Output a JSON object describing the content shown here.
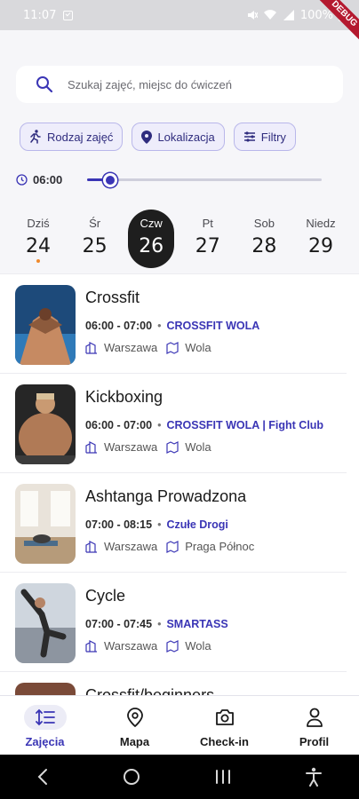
{
  "status_bar": {
    "time": "11:07",
    "battery": "100%",
    "debug_label": "DEBUG"
  },
  "search": {
    "placeholder": "Szukaj zajęć, miejsc do ćwiczeń"
  },
  "filters": {
    "chips": [
      "Rodzaj zajęć",
      "Lokalizacja",
      "Filtry"
    ]
  },
  "time_slider": {
    "label": "06:00",
    "value_fraction": 0.1
  },
  "days": [
    {
      "name": "Dziś",
      "num": "24",
      "today": true
    },
    {
      "name": "Śr",
      "num": "25"
    },
    {
      "name": "Czw",
      "num": "26",
      "selected": true
    },
    {
      "name": "Pt",
      "num": "27"
    },
    {
      "name": "Sob",
      "num": "28"
    },
    {
      "name": "Niedz",
      "num": "29"
    }
  ],
  "classes": [
    {
      "title": "Crossfit",
      "hours": "06:00 - 07:00",
      "club": "CROSSFIT WOLA",
      "city": "Warszawa",
      "district": "Wola"
    },
    {
      "title": "Kickboxing",
      "hours": "06:00 - 07:00",
      "club": "CROSSFIT WOLA | Fight Club",
      "city": "Warszawa",
      "district": "Wola"
    },
    {
      "title": "Ashtanga Prowadzona",
      "hours": "07:00 - 08:15",
      "club": "Czułe Drogi",
      "city": "Warszawa",
      "district": "Praga Północ"
    },
    {
      "title": "Cycle",
      "hours": "07:00 - 07:45",
      "club": "SMARTASS",
      "city": "Warszawa",
      "district": "Wola"
    },
    {
      "title": "Crossfit/beginners"
    }
  ],
  "nav": {
    "items": [
      "Zajęcia",
      "Mapa",
      "Check-in",
      "Profil"
    ],
    "active": "Zajęcia"
  },
  "colors": {
    "accent": "#3a35b5",
    "chip_bg": "#eeedfb",
    "today_dot": "#f08a2c"
  }
}
